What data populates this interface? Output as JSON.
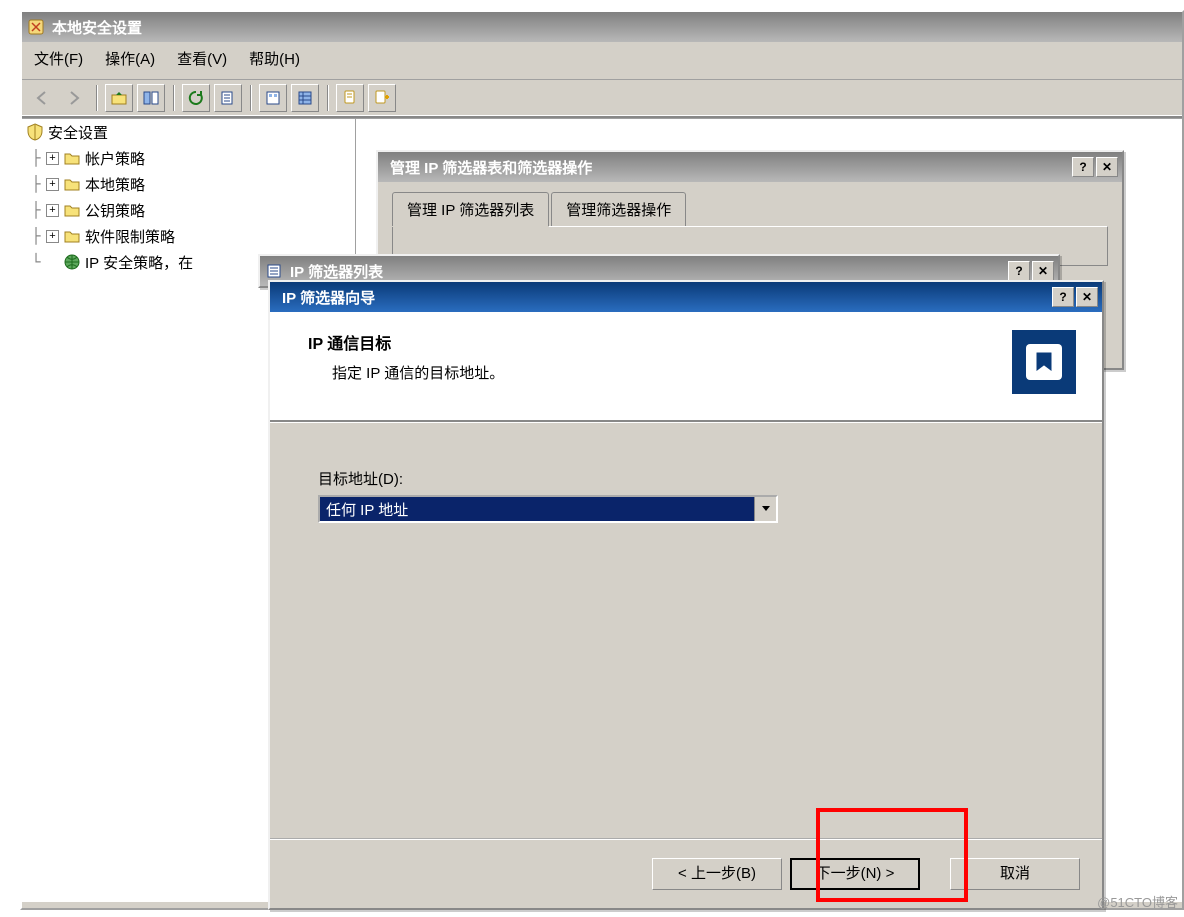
{
  "main_window": {
    "title": "本地安全设置",
    "menu": {
      "file": "文件(F)",
      "action": "操作(A)",
      "view": "查看(V)",
      "help": "帮助(H)"
    }
  },
  "tree": {
    "root": "安全设置",
    "items": [
      "帐户策略",
      "本地策略",
      "公钥策略",
      "软件限制策略",
      "IP 安全策略，在"
    ]
  },
  "dialog_manage": {
    "title": "管理 IP 筛选器表和筛选器操作",
    "tab1": "管理 IP 筛选器列表",
    "tab2": "管理筛选器操作"
  },
  "dialog_filterlist": {
    "title": "IP 筛选器列表"
  },
  "dialog_wizard": {
    "title": "IP 筛选器向导",
    "heading": "IP 通信目标",
    "subheading": "指定 IP 通信的目标地址。",
    "dest_label": "目标地址(D):",
    "dest_value": "任何 IP 地址",
    "btn_back": "< 上一步(B)",
    "btn_next": "下一步(N) >",
    "btn_cancel": "取消"
  },
  "watermark": "@51CTO博客"
}
